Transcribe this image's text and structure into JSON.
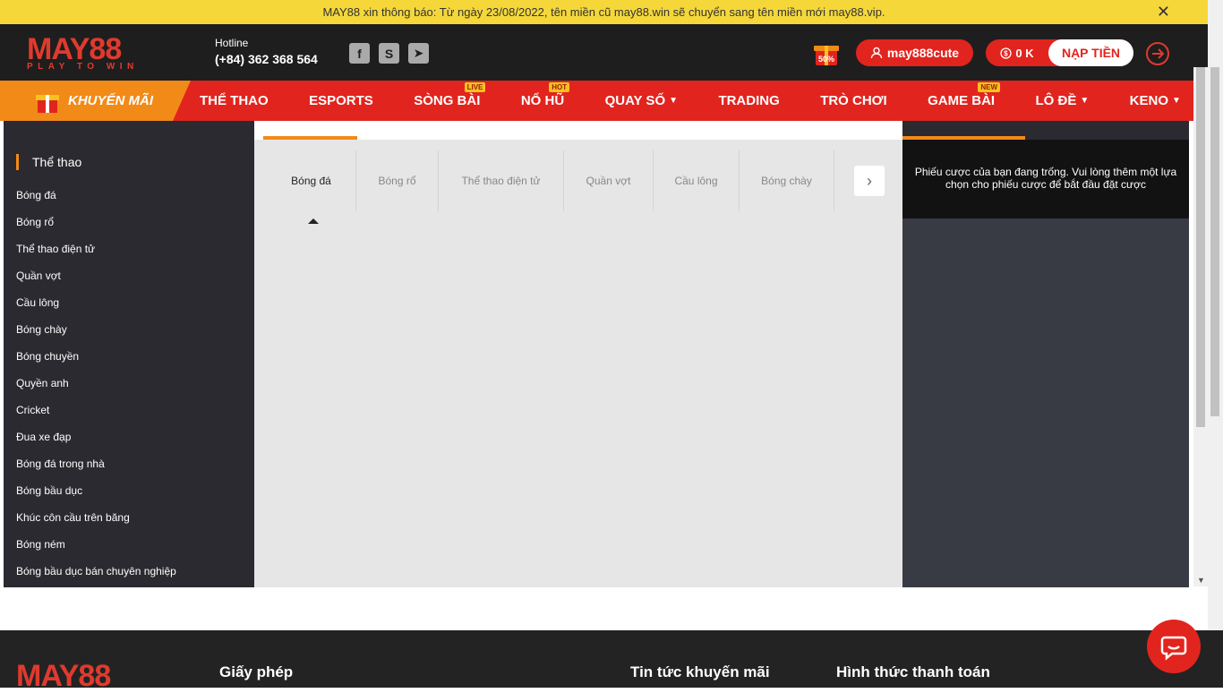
{
  "notice": {
    "text": "MAY88 xin thông báo: Từ ngày 23/08/2022, tên miền cũ may88.win sẽ chuyển sang tên miền mới may88.vip."
  },
  "logo": {
    "brand": "MAY88",
    "tagline": "PLAY TO WIN"
  },
  "hotline": {
    "label": "Hotline",
    "number": "(+84) 362 368 564"
  },
  "header": {
    "promo_badge": "50%",
    "username": "may888cute",
    "balance": "0 K",
    "deposit_label": "NẠP TIỀN"
  },
  "nav": {
    "promo_label": "KHUYẾN MÃI",
    "items": [
      {
        "label": "THỂ THAO",
        "badge": ""
      },
      {
        "label": "ESPORTS",
        "badge": ""
      },
      {
        "label": "SÒNG BÀI",
        "badge": "LIVE"
      },
      {
        "label": "NỔ HŨ",
        "badge": "HOT"
      },
      {
        "label": "QUAY SỐ",
        "badge": ""
      },
      {
        "label": "TRADING",
        "badge": ""
      },
      {
        "label": "TRÒ CHƠI",
        "badge": ""
      },
      {
        "label": "GAME BÀI",
        "badge": "NEW"
      },
      {
        "label": "LÔ ĐỀ",
        "badge": ""
      },
      {
        "label": "KENO",
        "badge": ""
      }
    ]
  },
  "sidebar": {
    "section_title": "Thể thao",
    "items": [
      "Bóng đá",
      "Bóng rổ",
      "Thể thao điện tử",
      "Quần vợt",
      "Cầu lông",
      "Bóng chày",
      "Bóng chuyền",
      "Quyền anh",
      "Cricket",
      "Đua xe đạp",
      "Bóng đá trong nhà",
      "Bóng bầu dục",
      "Khúc côn cầu trên băng",
      "Bóng ném",
      "Bóng bầu dục bán chuyên nghiệp"
    ]
  },
  "sports_tabs": [
    "Bóng đá",
    "Bóng rổ",
    "Thể thao điện tử",
    "Quần vợt",
    "Cầu lông",
    "Bóng chày"
  ],
  "betslip": {
    "empty_message": "Phiếu cược của bạn đang trống. Vui lòng thêm một lựa chọn cho phiếu cược để bắt đầu đặt cược"
  },
  "footer": {
    "brand": "MAY88",
    "headings": [
      "Giấy phép",
      "Tin tức khuyến mãi",
      "Hình thức thanh toán"
    ]
  },
  "colors": {
    "brand_red": "#e2241e",
    "accent_orange": "#f28a18",
    "notice_yellow": "#f5d73a"
  }
}
